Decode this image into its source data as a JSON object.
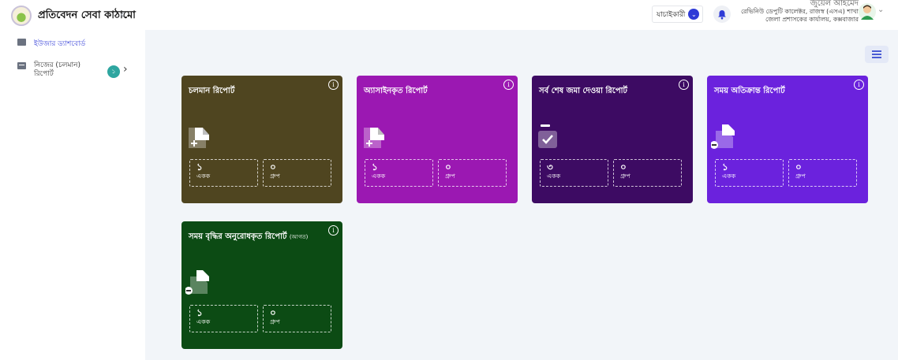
{
  "app": {
    "title": "প্রতিবেদন সেবা কাঠামো",
    "collapse_icon": "chevron-left-icon"
  },
  "header": {
    "role_label": "যাচাইকারী",
    "user_name": "জুয়েল আহমেদ",
    "user_designation": "রেভিনিউ ডেপুটি কালেক্টর, রাজস্ব (এসএ) শাখা",
    "user_office": "জেলা প্রশাসকের কার্যালয়, কক্সবাজার"
  },
  "sidebar": {
    "items": [
      {
        "label": "ইউজার ড্যাশবোর্ড",
        "icon": "briefcase-icon",
        "active": true
      },
      {
        "label": "নিজের (চলমান) রিপোর্ট",
        "icon": "report-icon",
        "badge": "১"
      }
    ]
  },
  "cards": [
    {
      "title": "চলমান রিপোর্ট",
      "subtitle": "",
      "color": "#4f4520",
      "icon": "add-document-icon",
      "stats": [
        {
          "value": "১",
          "label": "একক"
        },
        {
          "value": "০",
          "label": "গ্রুপ"
        }
      ]
    },
    {
      "title": "অ্যাসাইনকৃত রিপোর্ট",
      "subtitle": "",
      "color": "#9b18b2",
      "icon": "add-document-icon",
      "stats": [
        {
          "value": "১",
          "label": "একক"
        },
        {
          "value": "০",
          "label": "গ্রুপ"
        }
      ]
    },
    {
      "title": "সর্ব শেষ জমা দেওয়া রিপোর্ট",
      "subtitle": "",
      "color": "#3d0b63",
      "icon": "check-document-icon",
      "stats": [
        {
          "value": "৩",
          "label": "একক"
        },
        {
          "value": "০",
          "label": "গ্রুপ"
        }
      ]
    },
    {
      "title": "সময় অতিক্রান্ত রিপোর্ট",
      "subtitle": "",
      "color": "#6b22dd",
      "icon": "minus-document-icon",
      "stats": [
        {
          "value": "১",
          "label": "একক"
        },
        {
          "value": "০",
          "label": "গ্রুপ"
        }
      ]
    },
    {
      "title": "সময় বৃদ্ধির অনুরোধকৃত রিপোর্ট",
      "subtitle": "(আগত)",
      "color": "#0c4b14",
      "icon": "minus-document-icon",
      "stats": [
        {
          "value": "১",
          "label": "একক"
        },
        {
          "value": "০",
          "label": "গ্রুপ"
        }
      ]
    }
  ]
}
